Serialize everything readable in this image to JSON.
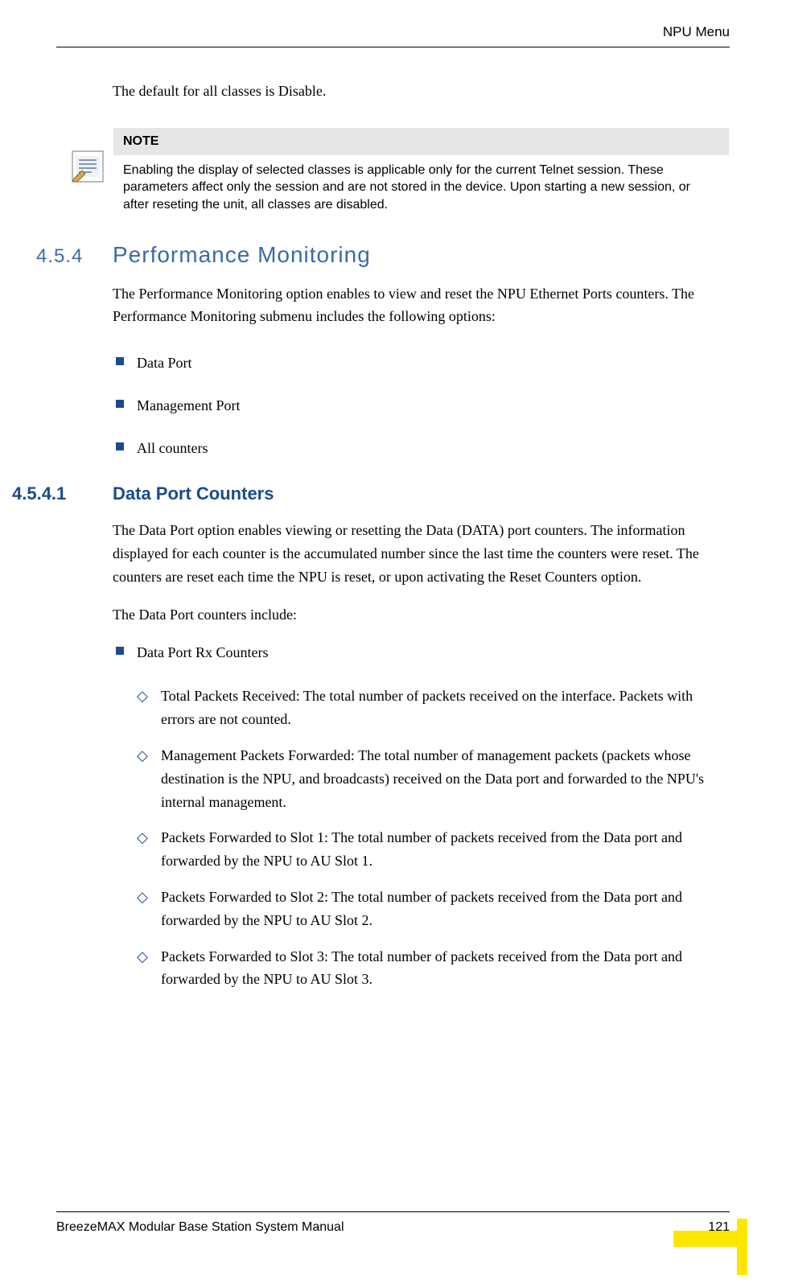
{
  "header": {
    "title": "NPU Menu"
  },
  "intro_para": "The default for all classes is Disable.",
  "note": {
    "label": "NOTE",
    "text": "Enabling the display of selected classes is applicable only for the current Telnet session. These parameters affect only the session and are not stored in the device. Upon starting a new session, or after reseting the unit, all classes are disabled."
  },
  "section": {
    "num": "4.5.4",
    "title": "Performance Monitoring",
    "para": "The Performance Monitoring option enables to view and reset the NPU Ethernet Ports counters. The Performance Monitoring submenu includes the following options:",
    "bullets": [
      "Data Port",
      "Management Port",
      "All counters"
    ]
  },
  "subsection": {
    "num": "4.5.4.1",
    "title": "Data Port Counters",
    "para1": "The Data Port option enables viewing or resetting the Data (DATA) port counters. The information displayed for each counter is the accumulated number since the last time the counters were reset. The counters are reset each time the NPU is reset, or upon activating the Reset Counters option.",
    "para2": "The Data Port counters include:",
    "group_title": "Data Port Rx Counters",
    "items": [
      "Total Packets Received: The total number of packets received on the interface. Packets with errors are not counted.",
      "Management Packets Forwarded: The total number of management packets (packets whose destination is the NPU, and broadcasts) received on the Data port and forwarded to the NPU's internal management.",
      "Packets Forwarded to Slot 1: The total number of packets received from the Data port and forwarded by the NPU to AU Slot 1.",
      "Packets Forwarded to Slot 2: The total number of packets received from the Data port and forwarded by the NPU to AU Slot 2.",
      "Packets Forwarded to Slot 3: The total number of packets received from the Data port and forwarded by the NPU to AU Slot 3."
    ]
  },
  "footer": {
    "left": "BreezeMAX Modular Base Station System Manual",
    "page": "121"
  }
}
